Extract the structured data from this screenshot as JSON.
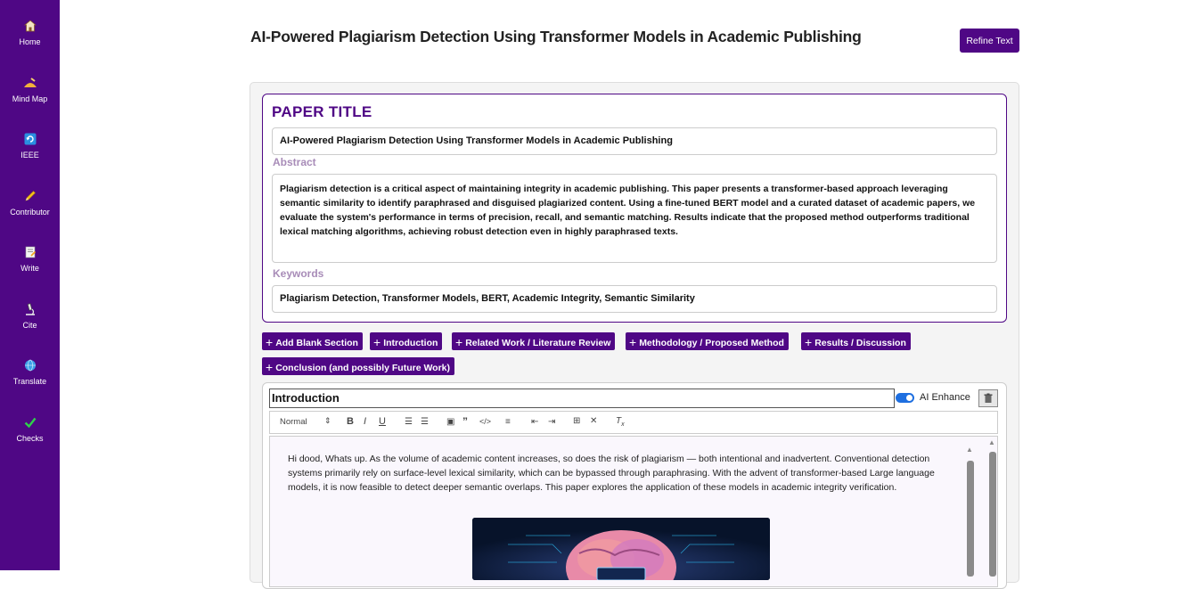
{
  "sidebar": {
    "items": [
      {
        "label": "Home",
        "icon": "home-icon",
        "glyph": "⌂"
      },
      {
        "label": "Mind Map",
        "icon": "mind-map-icon",
        "glyph": "✎"
      },
      {
        "label": "IEEE",
        "icon": "refresh-icon",
        "glyph": "⟳"
      },
      {
        "label": "Contributor",
        "icon": "pencil-icon",
        "glyph": "✏"
      },
      {
        "label": "Write",
        "icon": "notepad-icon",
        "glyph": "✍"
      },
      {
        "label": "Cite",
        "icon": "microscope-icon",
        "glyph": "⚗"
      },
      {
        "label": "Translate",
        "icon": "globe-icon",
        "glyph": "◍"
      },
      {
        "label": "Checks",
        "icon": "checkmark-icon",
        "glyph": "✔"
      }
    ]
  },
  "header": {
    "title": "AI-Powered Plagiarism Detection Using Transformer Models in Academic Publishing",
    "refine_label": "Refine Text"
  },
  "paper": {
    "heading": "PAPER TITLE",
    "title_value": "AI-Powered Plagiarism Detection Using Transformer Models in Academic Publishing",
    "abstract_label": "Abstract",
    "abstract_value": "Plagiarism detection is a critical aspect of maintaining integrity in academic publishing. This paper presents a transformer-based approach leveraging semantic similarity to identify paraphrased and disguised plagiarized content. Using a fine-tuned BERT model and a curated dataset of academic papers, we evaluate the system's performance in terms of precision, recall, and semantic matching. Results indicate that the proposed method outperforms traditional lexical matching algorithms, achieving robust detection even in highly paraphrased texts.",
    "keywords_label": "Keywords",
    "keywords_value": "Plagiarism Detection, Transformer Models, BERT, Academic Integrity, Semantic Similarity"
  },
  "section_buttons": [
    "Add Blank Section",
    "Introduction",
    "Related Work / Literature Review",
    "Methodology / Proposed Method",
    "Results / Discussion",
    "Conclusion (and possibly Future Work)"
  ],
  "section": {
    "title": "Introduction",
    "ai_enhance_label": "AI Enhance",
    "ai_enhance_on": true,
    "toolbar": {
      "format_select": "Normal",
      "bold": "B",
      "italic": "I",
      "underline": "U"
    },
    "content": "Hi dood, Whats up.  As the volume of academic content increases, so does the risk of plagiarism — both intentional and inadvertent. Conventional detection systems primarily rely on surface-level lexical similarity, which can be bypassed through paraphrasing. With the advent of transformer-based Large language models, it is now feasible to detect deeper semantic overlaps. This paper explores the application of these models in academic integrity verification."
  },
  "colors": {
    "brand_purple": "#4f0785",
    "toggle_blue": "#1e6fe0",
    "label_muted": "#a88cb8"
  }
}
